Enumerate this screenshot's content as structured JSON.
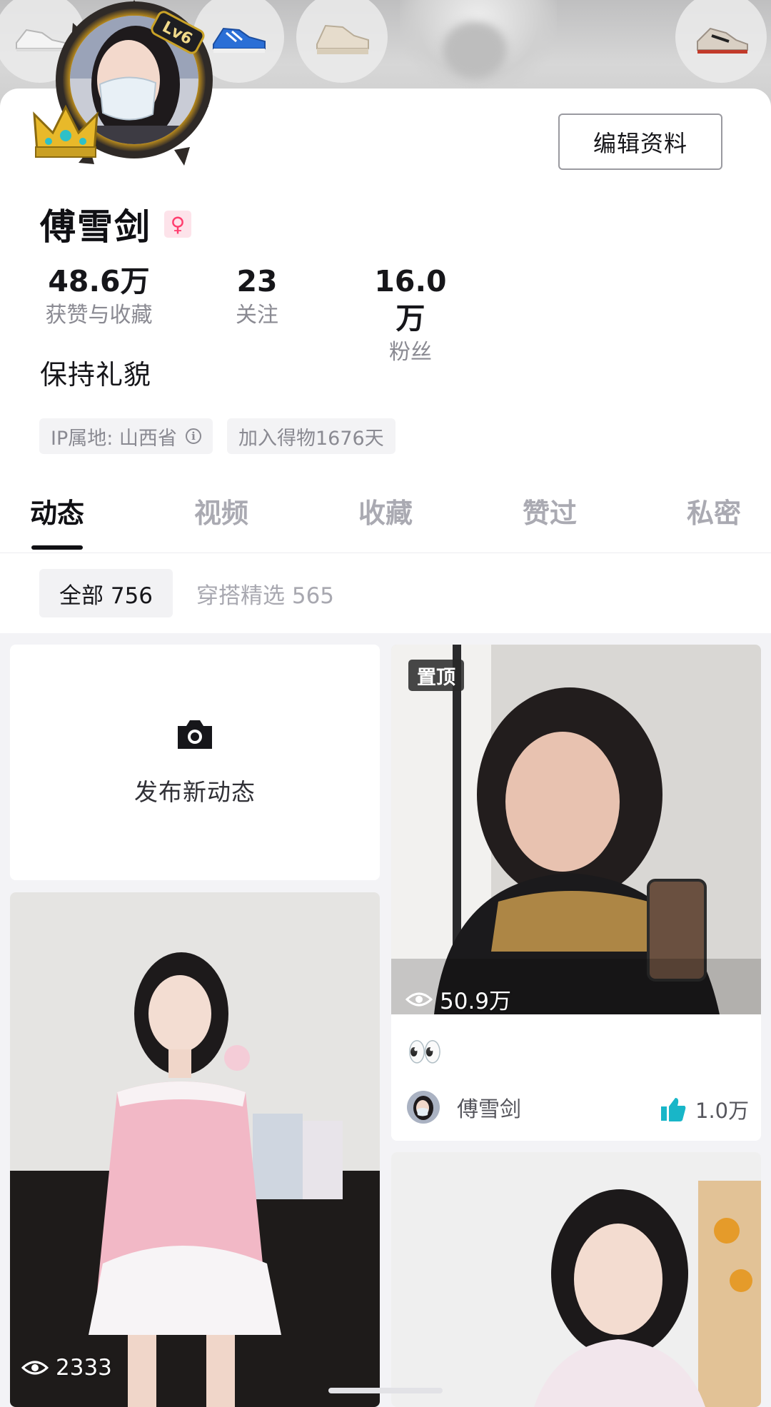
{
  "profile": {
    "level_badge": "Lv6",
    "edit_button": "编辑资料",
    "name": "傅雪剑",
    "gender_symbol": "♀",
    "stats": [
      {
        "value": "48.6万",
        "label": "获赞与收藏"
      },
      {
        "value": "23",
        "label": "关注"
      },
      {
        "value": "16.0万",
        "label": "粉丝"
      }
    ],
    "bio": "保持礼貌",
    "ip_location": "IP属地: 山西省",
    "ip_info_icon": "i",
    "joined": "加入得物1676天"
  },
  "tabs": [
    "动态",
    "视频",
    "收藏",
    "赞过",
    "私密"
  ],
  "active_tab": "动态",
  "filters": [
    {
      "label": "全部 756",
      "active": true
    },
    {
      "label": "穿搭精选 565",
      "active": false
    }
  ],
  "feed": {
    "new_post_label": "发布新动态",
    "pinned_card": {
      "badge": "置顶",
      "views": "50.9万",
      "caption": "👀",
      "author": "傅雪剑",
      "likes": "1.0万"
    },
    "left_photo_views": "2333"
  },
  "colors": {
    "accent_like": "#18b6c8",
    "gender_pink": "#ff3d6e",
    "level_gold": "#c9a227"
  },
  "icons": [
    "camera-icon",
    "eye-icon",
    "thumbs-up-icon",
    "info-icon",
    "crown-icon",
    "sneaker-icon"
  ]
}
